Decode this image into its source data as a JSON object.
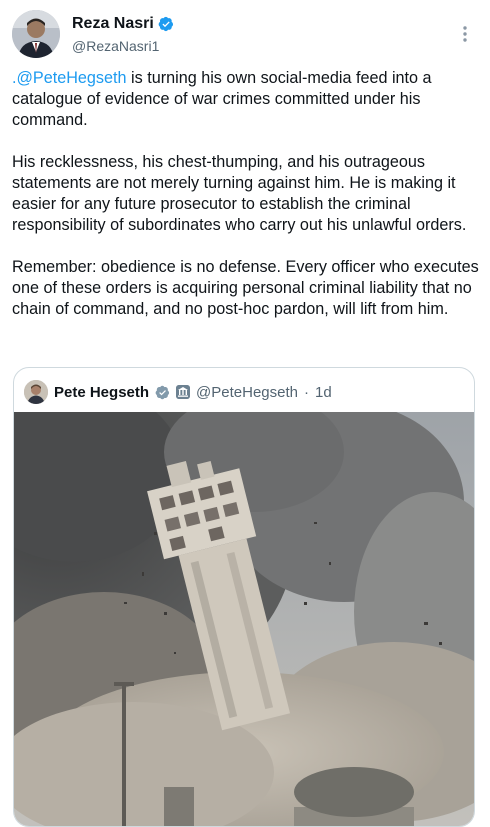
{
  "author": {
    "display_name": "Reza Nasri",
    "handle": "@RezaNasri1",
    "verified": true,
    "avatar_icon": "profile-photo"
  },
  "tweet": {
    "paragraphs": [
      {
        "mention": ".@PeteHegseth",
        "text": " is turning his own social-media feed into a catalogue of evidence of war crimes committed under his command."
      },
      {
        "mention": "",
        "text": "His recklessness, his chest-thumping, and his outrageous statements are not merely turning against him. He is making it easier for any future prosecutor to establish the criminal responsibility of subordinates who carry out his unlawful orders."
      },
      {
        "mention": "",
        "text": "Remember: obedience is no defense. Every officer who executes one of these orders is acquiring personal criminal liability that no chain of command, and no post-hoc pardon, will lift from him."
      }
    ]
  },
  "quoted_tweet": {
    "display_name": "Pete Hegseth",
    "handle": "@PeteHegseth",
    "separator": "·",
    "time": "1d",
    "verified": true,
    "government_badge": true,
    "media": "collapsing-building-photo"
  },
  "colors": {
    "accent": "#1d9bf0",
    "text": "#0f1419",
    "secondary": "#536471",
    "border": "#cfd9de"
  },
  "icons": {
    "more": "more-vertical-icon",
    "verified": "verified-badge-icon"
  }
}
